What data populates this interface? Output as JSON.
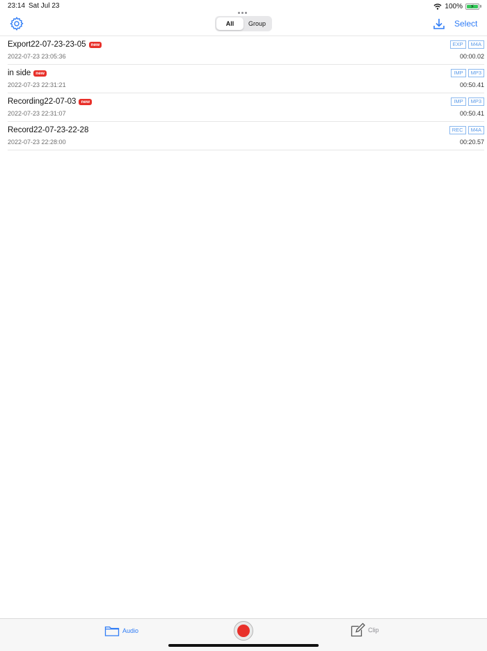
{
  "status": {
    "time": "23:14",
    "date": "Sat Jul 23",
    "battery": "100%"
  },
  "nav": {
    "segments": [
      "All",
      "Group"
    ],
    "active_segment": "All",
    "select_label": "Select"
  },
  "recordings": [
    {
      "title": "Export22-07-23-23-05",
      "badge": "new",
      "date": "2022-07-23 23:05:36",
      "tags": [
        "EXP",
        "M4A"
      ],
      "duration": "00:00.02"
    },
    {
      "title": "in side",
      "badge": "new",
      "date": "2022-07-23 22:31:21",
      "tags": [
        "IMP",
        "MP3"
      ],
      "duration": "00:50.41"
    },
    {
      "title": "Recording22-07-03",
      "badge": "new",
      "date": "2022-07-23 22:31:07",
      "tags": [
        "IMP",
        "MP3"
      ],
      "duration": "00:50.41"
    },
    {
      "title": "Record22-07-23-22-28",
      "badge": "",
      "date": "2022-07-23 22:28:00",
      "tags": [
        "REC",
        "M4A"
      ],
      "duration": "00:20.57"
    }
  ],
  "tabbar": {
    "audio_label": "Audio",
    "clip_label": "Clip"
  },
  "colors": {
    "accent": "#2f7cf6",
    "badge": "#e8302a",
    "record": "#e8302a"
  }
}
